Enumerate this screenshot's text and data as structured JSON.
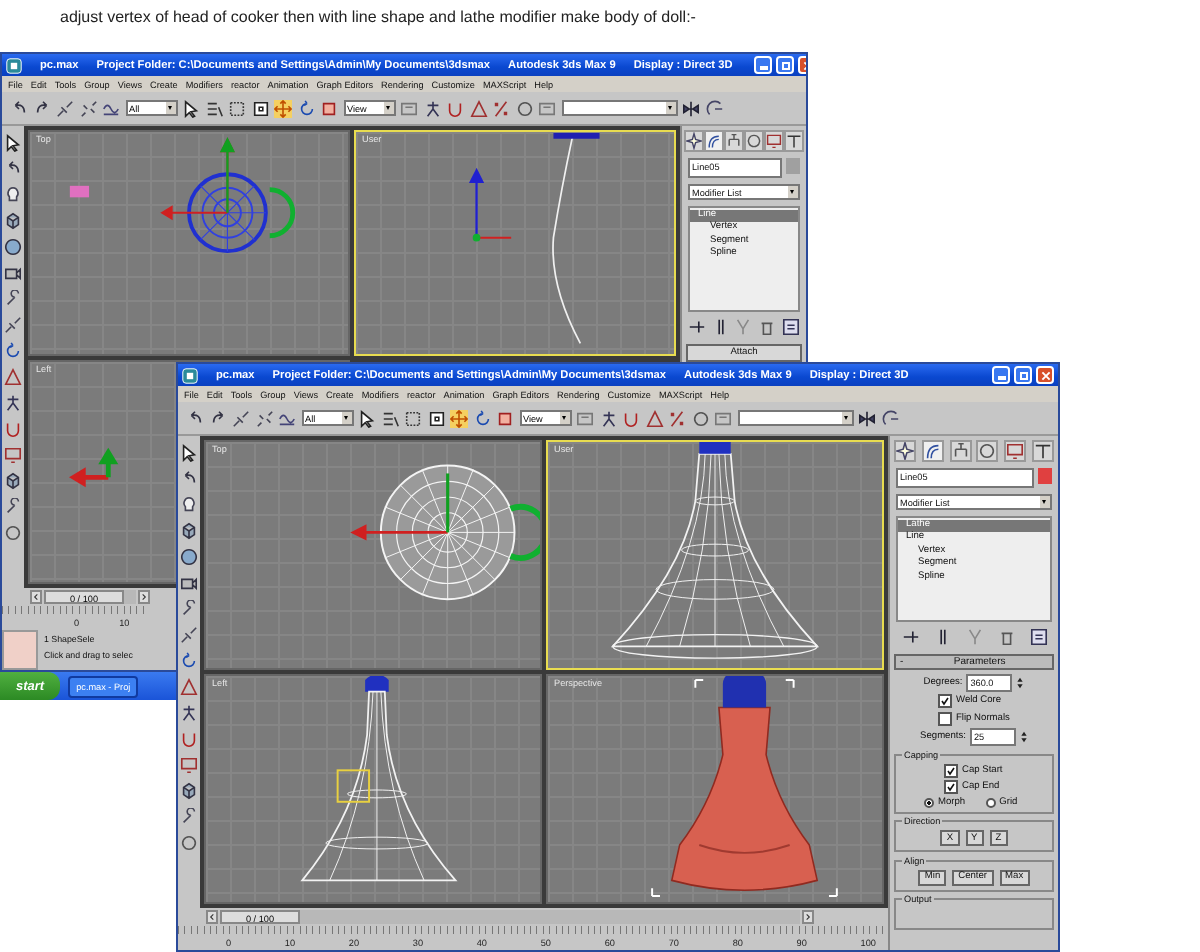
{
  "caption": "adjust vertex of head of cooker then with line shape and lathe modifier make body of doll:-",
  "windows": [
    {
      "title_parts": [
        "pc.max",
        "Project Folder: C:\\Documents and Settings\\Admin\\My Documents\\3dsmax",
        "Autodesk 3ds Max 9",
        "Display : Direct 3D"
      ],
      "menu": [
        "File",
        "Edit",
        "Tools",
        "Group",
        "Views",
        "Create",
        "Modifiers",
        "reactor",
        "Animation",
        "Graph Editors",
        "Rendering",
        "Customize",
        "MAXScript",
        "Help"
      ],
      "selection_filter": "All",
      "reference_coord": "View",
      "viewports": [
        {
          "label": "Top",
          "kind": "cooker-top",
          "selected": false
        },
        {
          "label": "User",
          "kind": "profile",
          "selected": true
        },
        {
          "label": "Left",
          "kind": "gizmo",
          "selected": false
        }
      ],
      "object_name": "Line05",
      "modifier_list": "Modifier List",
      "stack": [
        {
          "label": "Line",
          "selected": true,
          "children": [
            {
              "label": "Vertex"
            },
            {
              "label": "Segment"
            },
            {
              "label": "Spline"
            }
          ]
        }
      ],
      "rollout": {
        "kind": "attach",
        "button": "Attach"
      },
      "time_slider": {
        "label": "0 / 100",
        "level": 0
      },
      "ruler": [
        "0",
        "10"
      ],
      "status": {
        "selection": "1 ShapeSele",
        "prompt": "Click and drag to selec"
      }
    },
    {
      "title_parts": [
        "pc.max",
        "Project Folder: C:\\Documents and Settings\\Admin\\My Documents\\3dsmax",
        "Autodesk 3ds Max 9",
        "Display : Direct 3D"
      ],
      "menu": [
        "File",
        "Edit",
        "Tools",
        "Group",
        "Views",
        "Create",
        "Modifiers",
        "reactor",
        "Animation",
        "Graph Editors",
        "Rendering",
        "Customize",
        "MAXScript",
        "Help"
      ],
      "selection_filter": "All",
      "reference_coord": "View",
      "viewports": [
        {
          "label": "Top",
          "kind": "sphere-top",
          "selected": false
        },
        {
          "label": "User",
          "kind": "lathe-wire",
          "selected": true
        },
        {
          "label": "Left",
          "kind": "lathe-small",
          "selected": false
        },
        {
          "label": "Perspective",
          "kind": "doll-shaded",
          "selected": false
        }
      ],
      "object_name": "Line05",
      "modifier_list": "Modifier List",
      "stack": [
        {
          "label": "Lathe",
          "selected": true
        },
        {
          "label": "Line",
          "selected": false,
          "children": [
            {
              "label": "Vertex"
            },
            {
              "label": "Segment"
            },
            {
              "label": "Spline"
            }
          ]
        }
      ],
      "rollout": {
        "kind": "lathe",
        "collapse": "-",
        "title": "Parameters",
        "degrees_label": "Degrees:",
        "degrees": "360.0",
        "options": [
          {
            "label": "Weld Core",
            "checked": true
          },
          {
            "label": "Flip Normals",
            "checked": false
          }
        ],
        "segments_label": "Segments:",
        "segments": "25",
        "capping": {
          "title": "Capping",
          "options": [
            {
              "label": "Cap Start",
              "checked": true
            },
            {
              "label": "Cap End",
              "checked": true
            }
          ],
          "types": [
            {
              "label": "Morph",
              "selected": true
            },
            {
              "label": "Grid",
              "selected": false
            }
          ]
        },
        "direction": {
          "title": "Direction",
          "buttons": [
            "X",
            "Y",
            "Z"
          ]
        },
        "align": {
          "title": "Align",
          "buttons": [
            "Min",
            "Center",
            "Max"
          ]
        },
        "output": {
          "title": "Output"
        }
      },
      "time_slider": {
        "label": "0 / 100",
        "level": 0
      },
      "ruler": [
        "0",
        "10",
        "20",
        "30",
        "40",
        "50",
        "60",
        "70",
        "80",
        "90",
        "100"
      ]
    }
  ],
  "taskbar": {
    "start": "start",
    "task": "pc.max - Proj"
  }
}
